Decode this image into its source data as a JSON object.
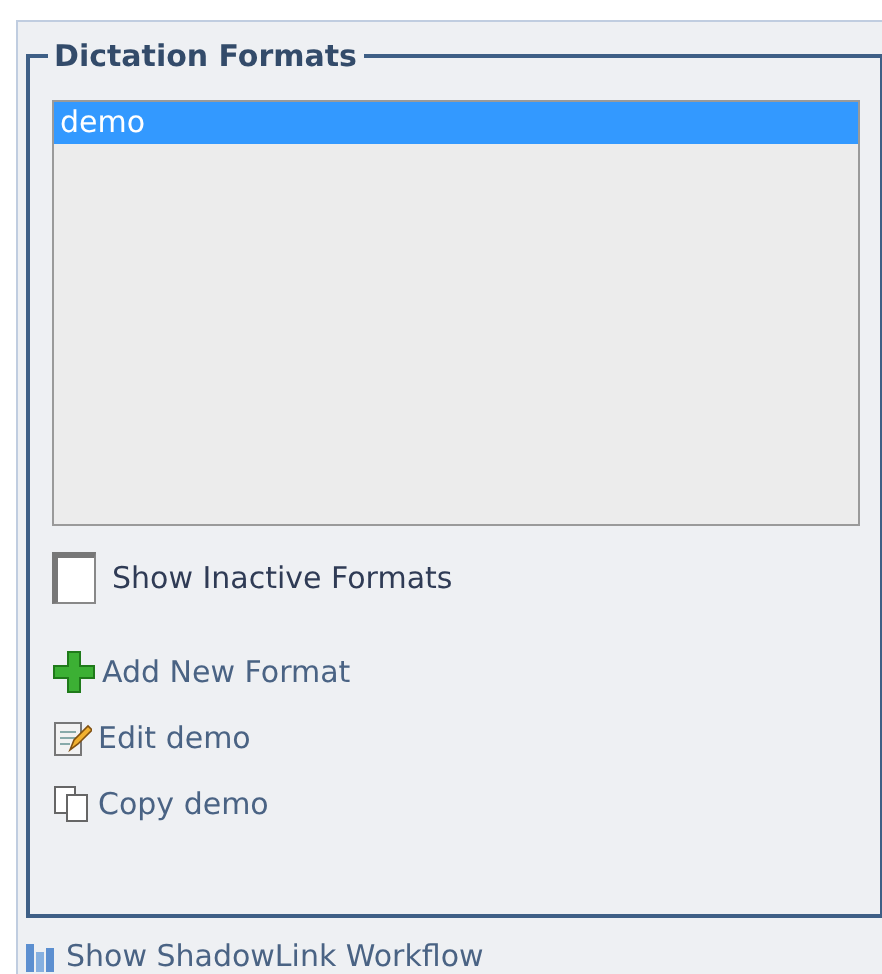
{
  "panel": {
    "title": "Dictation Formats",
    "formats": [
      {
        "name": "demo",
        "selected": true
      }
    ],
    "show_inactive": {
      "label": "Show Inactive Formats",
      "checked": false
    },
    "actions": [
      {
        "kind": "add",
        "label": "Add New Format"
      },
      {
        "kind": "edit",
        "label": "Edit demo"
      },
      {
        "kind": "copy",
        "label": "Copy demo"
      }
    ]
  },
  "footer_link": {
    "label": "Show ShadowLink Workflow"
  }
}
